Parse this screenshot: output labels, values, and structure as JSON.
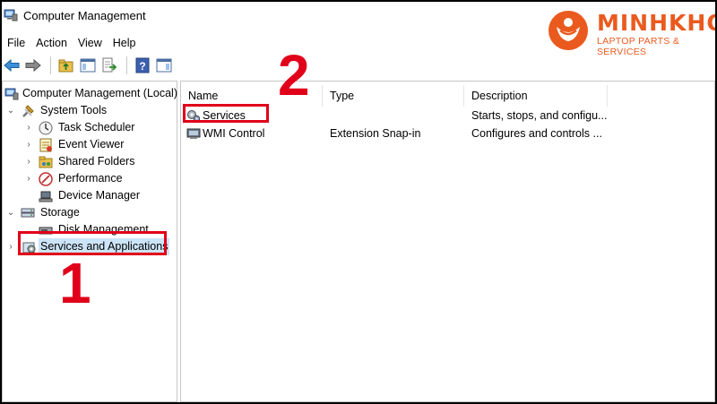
{
  "window": {
    "title": "Computer Management",
    "icon": "computer-management-icon"
  },
  "branding": {
    "name": "MINHKHOA",
    "tagline": "LAPTOP PARTS & SERVICES",
    "color": "#ea5a1e"
  },
  "menubar": {
    "items": [
      {
        "label": "File"
      },
      {
        "label": "Action"
      },
      {
        "label": "View"
      },
      {
        "label": "Help"
      }
    ]
  },
  "toolbar": {
    "buttons": [
      "back-arrow-icon",
      "forward-arrow-icon",
      "up-folder-icon",
      "show-hide-console-tree-icon",
      "export-list-icon",
      "help-icon",
      "show-hide-action-pane-icon"
    ]
  },
  "tree": {
    "root": {
      "label": "Computer Management (Local)",
      "icon": "computer-management-icon"
    },
    "system_tools": {
      "label": "System Tools",
      "icon": "tools-icon",
      "children": [
        {
          "label": "Task Scheduler",
          "icon": "clock-icon"
        },
        {
          "label": "Event Viewer",
          "icon": "event-viewer-icon"
        },
        {
          "label": "Shared Folders",
          "icon": "shared-folder-icon"
        },
        {
          "label": "Performance",
          "icon": "performance-icon"
        },
        {
          "label": "Device Manager",
          "icon": "device-manager-icon"
        }
      ]
    },
    "storage": {
      "label": "Storage",
      "icon": "storage-icon",
      "children": [
        {
          "label": "Disk Management",
          "icon": "disk-icon"
        }
      ]
    },
    "services_apps": {
      "label": "Services and Applications",
      "icon": "services-apps-icon",
      "selected": true
    }
  },
  "list": {
    "columns": [
      "Name",
      "Type",
      "Description"
    ],
    "rows": [
      {
        "name": "Services",
        "type": "",
        "description": "Starts, stops, and configu...",
        "icon": "services-gear-icon"
      },
      {
        "name": "WMI Control",
        "type": "Extension Snap-in",
        "description": "Configures and controls ...",
        "icon": "wmi-control-icon"
      }
    ]
  },
  "annotations": {
    "step1": "1",
    "step2": "2",
    "color": "#e1001a"
  }
}
